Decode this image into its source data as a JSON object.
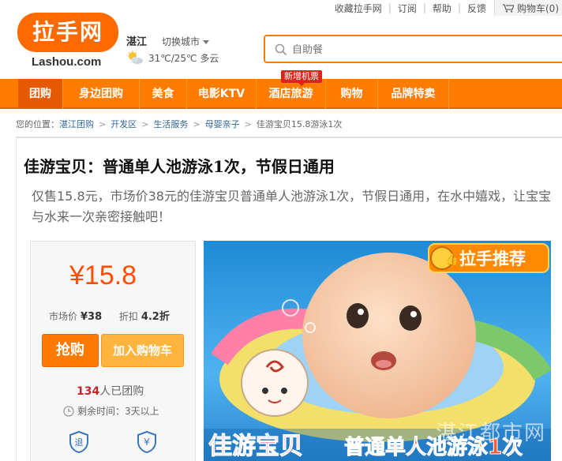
{
  "topbar": {
    "links": [
      "收藏拉手网",
      "订阅",
      "帮助",
      "反馈"
    ],
    "cart_label": "购物车(0)"
  },
  "logo": {
    "main": "拉手网",
    "sub": "Lashou.com"
  },
  "location": {
    "city": "湛江",
    "switch_label": "切换城市",
    "weather": "31℃/25℃ 多云"
  },
  "search": {
    "placeholder": "自助餐"
  },
  "nav": {
    "items": [
      "团购",
      "身边团购",
      "美食",
      "电影KTV",
      "酒店旅游",
      "购物",
      "品牌特卖"
    ],
    "active_index": 0,
    "badge": "新增机票"
  },
  "breadcrumb": {
    "prefix": "您的位置：",
    "items": [
      "湛江团购",
      "开发区",
      "生活服务",
      "母婴亲子"
    ],
    "current": "佳游宝贝15.8游泳1次"
  },
  "deal": {
    "title": "佳游宝贝：普通单人池游泳1次，节假日通用",
    "description": "仅售15.8元，市场价38元的佳游宝贝普通单人池游泳1次，节假日通用，在水中嬉戏，让宝宝与水来一次亲密接触吧！",
    "price": "¥15.8",
    "market_label": "市场价",
    "market_price": "¥38",
    "discount_label": "折扣",
    "discount": "4.2折",
    "buy_label": "抢购",
    "cart_label": "加入购物车",
    "sold_count": "134",
    "sold_suffix": "人已团购",
    "remain_label": "剩余时间：",
    "remain_value": "3天以上"
  },
  "image": {
    "badge": "拉手推荐",
    "caption_brand": "佳游宝贝",
    "caption_rest": "普通单人池游泳1次",
    "watermark": "湛江都市网"
  },
  "colors": {
    "brand_orange": "#ff7c00",
    "price_red": "#ff4e00",
    "link_blue": "#336699"
  }
}
